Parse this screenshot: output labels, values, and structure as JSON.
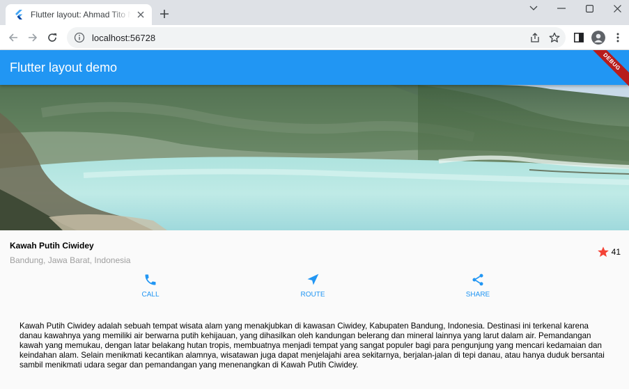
{
  "browser": {
    "tab_title": "Flutter layout: Ahmad Tito NH demo",
    "url": "localhost:56728"
  },
  "app": {
    "title": "Flutter layout demo",
    "debug_banner": "DEBUG",
    "accent_color": "#2196f3"
  },
  "place": {
    "name": "Kawah Putih Ciwidey",
    "location": "Bandung, Jawa Barat, Indonesia",
    "rating_count": "41",
    "star_color": "#f44336"
  },
  "actions": [
    {
      "icon": "phone-icon",
      "label": "CALL"
    },
    {
      "icon": "navigation-icon",
      "label": "ROUTE"
    },
    {
      "icon": "share-icon",
      "label": "SHARE"
    }
  ],
  "description": "Kawah Putih Ciwidey adalah sebuah tempat wisata alam yang menakjubkan di kawasan Ciwidey, Kabupaten Bandung, Indonesia. Destinasi ini terkenal karena danau kawahnya yang memiliki air berwarna putih kehijauan, yang dihasilkan oleh kandungan belerang dan mineral lainnya yang larut dalam air. Pemandangan kawah yang memukau, dengan latar belakang hutan tropis, membuatnya menjadi tempat yang sangat populer bagi para pengunjung yang mencari kedamaian dan keindahan alam. Selain menikmati kecantikan alamnya, wisatawan juga dapat menjelajahi area sekitarnya, berjalan-jalan di tepi danau, atau hanya duduk bersantai sambil menikmati udara segar dan pemandangan yang menenangkan di Kawah Putih Ciwidey."
}
